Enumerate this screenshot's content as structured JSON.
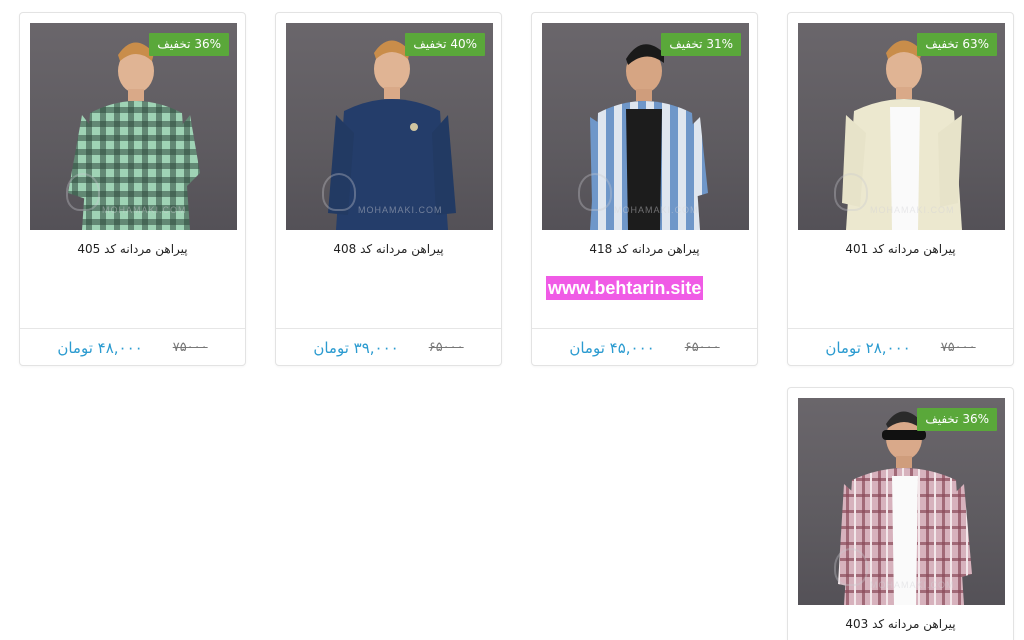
{
  "colors": {
    "badge": "#5aa83a",
    "price": "#2b9bd0",
    "watermark_bg": "#f05be6",
    "photo_bg": "#615e64"
  },
  "products": [
    {
      "title": "پیراهن مردانه کد 405",
      "discount": "36% تخفیف",
      "price": "۴۸,۰۰۰ تومان",
      "old_price": "۷۵۰۰۰",
      "image_label": "man in green plaid shirt",
      "shirt_color": "#8fc7a8"
    },
    {
      "title": "پیراهن مردانه کد 408",
      "discount": "40% تخفیف",
      "price": "۳۹,۰۰۰ تومان",
      "old_price": "۶۵۰۰۰",
      "image_label": "man in navy shirt",
      "shirt_color": "#223a63"
    },
    {
      "title": "پیراهن مردانه کد 418",
      "discount": "31% تخفیف",
      "price": "۴۵,۰۰۰ تومان",
      "old_price": "۶۵۰۰۰",
      "image_label": "man in blue striped shirt",
      "shirt_color": "#8eaed6",
      "overlay": "www.behtarin.site"
    },
    {
      "title": "پیراهن مردانه کد 401",
      "discount": "63% تخفیف",
      "price": "۲۸,۰۰۰ تومان",
      "old_price": "۷۵۰۰۰",
      "image_label": "man in cream shirt",
      "shirt_color": "#e7e3c9"
    },
    {
      "title": "پیراهن مردانه کد 403",
      "discount": "36% تخفیف",
      "image_label": "man in pink plaid shirt",
      "shirt_color": "#c99aa8"
    }
  ]
}
